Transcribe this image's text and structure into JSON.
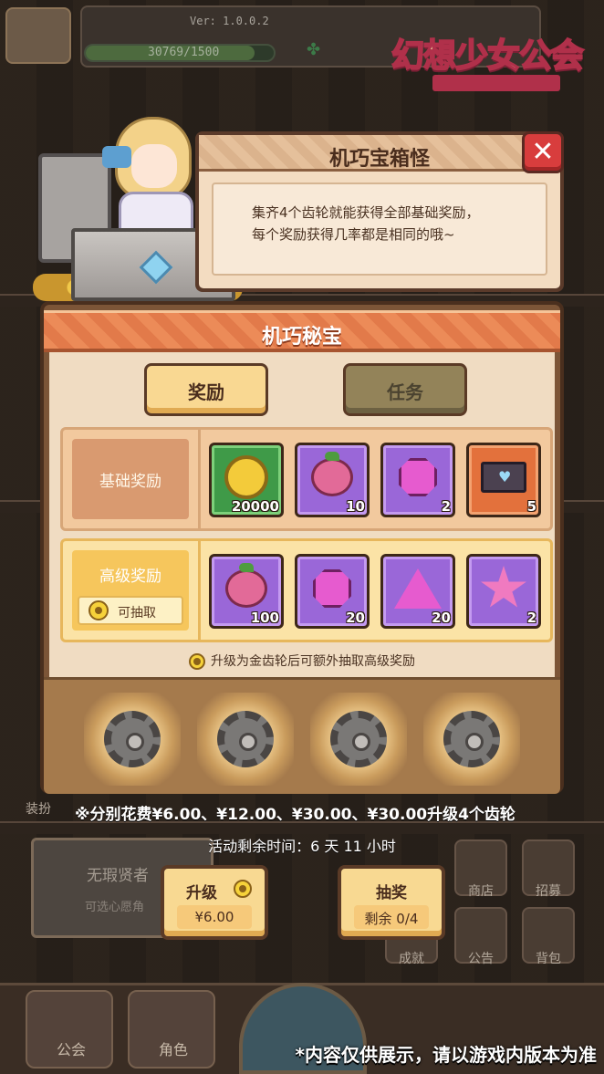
{
  "background": {
    "version": "Ver: 1.0.0.2",
    "energy": "30769/1500",
    "energy_fill": 0.9,
    "logo": "幻想少女公会",
    "sage_card": {
      "title": "无瑕贤者",
      "subtitle": "可选心愿角"
    },
    "side_buttons": {
      "shop": "商店",
      "recruit": "招募",
      "achievement": "成就",
      "announcement": "公告",
      "backpack": "背包",
      "dress_up": "装扮"
    },
    "nav": [
      "公会",
      "角色"
    ],
    "notice": "*内容仅供展示，请以游戏内版本为准"
  },
  "speech": {
    "title": "机巧宝箱怪",
    "lines": [
      "集齐4个齿轮就能获得全部基础奖励，",
      "每个奖励获得几率都是相同的哦~"
    ]
  },
  "panel": {
    "title": "机巧秘宝",
    "tabs": {
      "reward": "奖励",
      "task": "任务"
    },
    "basic": {
      "label": "基础奖励",
      "items": [
        {
          "icon": "gold-coin-icon",
          "count": "20000",
          "rarity": "green"
        },
        {
          "icon": "berry-icon",
          "count": "10",
          "rarity": "purple"
        },
        {
          "icon": "gem-icon",
          "count": "2",
          "rarity": "purple"
        },
        {
          "icon": "letter-icon",
          "count": "5",
          "rarity": "orange"
        }
      ]
    },
    "advanced": {
      "label": "高级奖励",
      "draw_tag": "可抽取",
      "items": [
        {
          "icon": "berry-icon",
          "count": "100",
          "rarity": "purple"
        },
        {
          "icon": "gem-icon",
          "count": "20",
          "rarity": "purple"
        },
        {
          "icon": "triangle-gem-icon",
          "count": "20",
          "rarity": "purple"
        },
        {
          "icon": "star-icon",
          "count": "2",
          "rarity": "purple"
        }
      ]
    },
    "upgrade_note": "升级为金齿轮后可额外抽取高级奖励",
    "gears": 4
  },
  "cost_note": "※分别花费¥6.00、¥12.00、¥30.00、¥30.00升级4个齿轮",
  "time_note": "活动剩余时间：6 天 11 小时",
  "buttons": {
    "upgrade": {
      "label": "升级",
      "price": "¥6.00"
    },
    "draw": {
      "label": "抽奖",
      "remaining": "剩余 0/4"
    }
  },
  "colors": {
    "title_bar": "#ec8b58",
    "panel_bg": "#f0dcc2",
    "slot_purple": "#9a67d8",
    "slot_green": "#3f9a48",
    "slot_orange": "#e3713c",
    "close_red": "#d83d3d"
  }
}
